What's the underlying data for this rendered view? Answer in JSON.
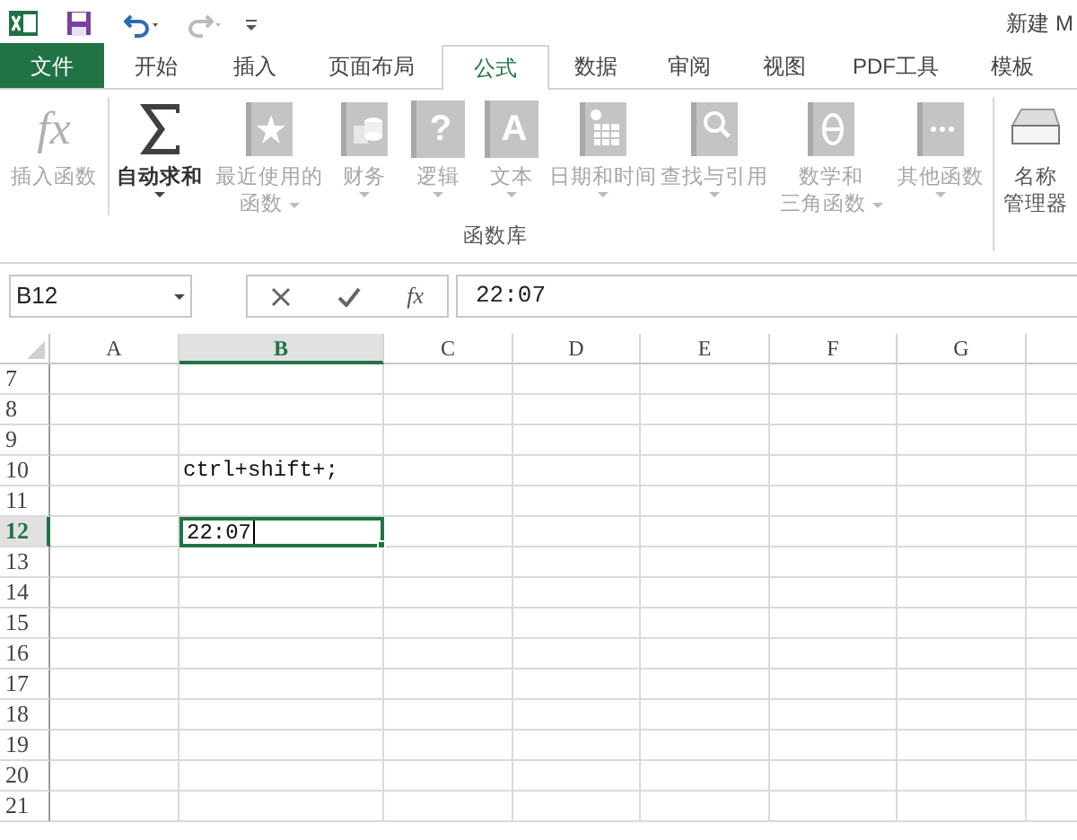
{
  "title_bar": {
    "title": "新建 M"
  },
  "tabs": [
    {
      "label": "文件",
      "kind": "file",
      "selected": false
    },
    {
      "label": "开始",
      "kind": "tab",
      "selected": false
    },
    {
      "label": "插入",
      "kind": "tab",
      "selected": false
    },
    {
      "label": "页面布局",
      "kind": "tab",
      "selected": false
    },
    {
      "label": "公式",
      "kind": "tab",
      "selected": true
    },
    {
      "label": "数据",
      "kind": "tab",
      "selected": false
    },
    {
      "label": "审阅",
      "kind": "tab",
      "selected": false
    },
    {
      "label": "视图",
      "kind": "tab",
      "selected": false
    },
    {
      "label": "PDF工具",
      "kind": "tab",
      "selected": false
    },
    {
      "label": "模板",
      "kind": "tab",
      "selected": false
    }
  ],
  "ribbon": {
    "group_label": "函数库",
    "buttons": [
      {
        "kind": "fx",
        "glyph": "fx",
        "label": "插入函数",
        "disabled": true,
        "dropdown": false
      },
      {
        "kind": "sigma",
        "label": "自动求和",
        "disabled": false,
        "dropdown": true
      },
      {
        "kind": "star",
        "label": "最近使用的",
        "label_line2": "函数",
        "disabled": true,
        "dropdown": true
      },
      {
        "kind": "coins",
        "label": "财务",
        "disabled": true,
        "dropdown": true
      },
      {
        "kind": "question",
        "glyph": "?",
        "label": "逻辑",
        "disabled": true,
        "dropdown": true
      },
      {
        "kind": "letter",
        "glyph": "A",
        "label": "文本",
        "disabled": true,
        "dropdown": true
      },
      {
        "kind": "calendar",
        "label": "日期和时间",
        "disabled": true,
        "dropdown": true
      },
      {
        "kind": "magnifier",
        "label": "查找与引用",
        "disabled": true,
        "dropdown": true
      },
      {
        "kind": "theta",
        "label": "数学和",
        "label_line2": "三角函数",
        "disabled": true,
        "dropdown": true
      },
      {
        "kind": "dots",
        "label": "其他函数",
        "disabled": true,
        "dropdown": true
      }
    ],
    "name_manager": {
      "label": "名称",
      "label_line2": "管理器",
      "disabled": false
    }
  },
  "formula_bar": {
    "name_box": "B12",
    "fx_glyph": "fx",
    "value": "22:07"
  },
  "sheet": {
    "columns": [
      {
        "label": "A",
        "selected": false
      },
      {
        "label": "B",
        "selected": true
      },
      {
        "label": "C",
        "selected": false
      },
      {
        "label": "D",
        "selected": false
      },
      {
        "label": "E",
        "selected": false
      },
      {
        "label": "F",
        "selected": false
      },
      {
        "label": "G",
        "selected": false
      }
    ],
    "rows": [
      {
        "header": "7",
        "selected": false
      },
      {
        "header": "8",
        "selected": false
      },
      {
        "header": "9",
        "selected": false
      },
      {
        "header": "10",
        "selected": false,
        "b": "ctrl+shift+;"
      },
      {
        "header": "11",
        "selected": false
      },
      {
        "header": "12",
        "selected": true,
        "b": "22:07"
      },
      {
        "header": "13",
        "selected": false
      },
      {
        "header": "14",
        "selected": false
      },
      {
        "header": "15",
        "selected": false
      },
      {
        "header": "16",
        "selected": false
      },
      {
        "header": "17",
        "selected": false
      },
      {
        "header": "18",
        "selected": false
      },
      {
        "header": "19",
        "selected": false
      },
      {
        "header": "20",
        "selected": false
      },
      {
        "header": "21",
        "selected": false
      }
    ]
  }
}
